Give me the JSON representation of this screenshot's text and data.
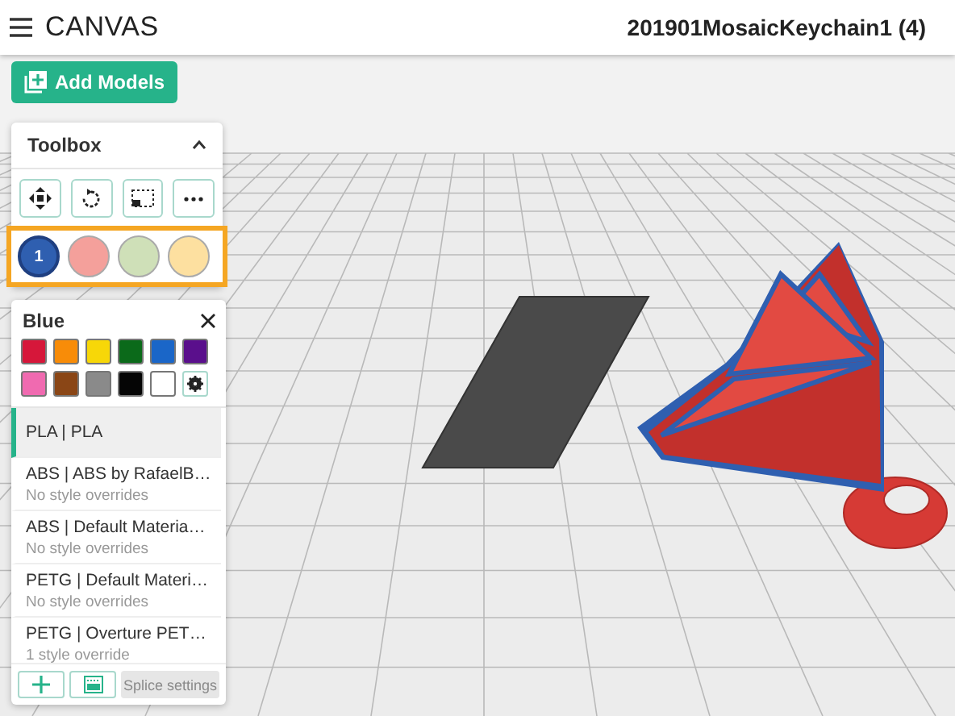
{
  "header": {
    "app_name": "CANVAS",
    "project_title": "201901MosaicKeychain1 (4)"
  },
  "add_models_button": "Add Models",
  "toolbox": {
    "title": "Toolbox",
    "expanded": true,
    "extruders": [
      {
        "label": "1",
        "color": "#2f5fb0",
        "selected": true
      },
      {
        "color": "#f4a09b",
        "selected": false
      },
      {
        "color": "#cfe0b8",
        "selected": false
      },
      {
        "color": "#fde0a0",
        "selected": false
      }
    ]
  },
  "color_panel": {
    "title": "Blue",
    "swatches": [
      {
        "color": "#d6173a"
      },
      {
        "color": "#f88c08"
      },
      {
        "color": "#f7d708"
      },
      {
        "color": "#0b6a1a"
      },
      {
        "color": "#1a66c8"
      },
      {
        "color": "#5a0f8c"
      },
      {
        "color": "#f06ab0"
      },
      {
        "color": "#8a4616"
      },
      {
        "color": "#8a8a8a"
      },
      {
        "color": "#050505"
      },
      {
        "color": "#ffffff"
      }
    ],
    "materials": [
      {
        "name": "PLA | PLA",
        "selected": true
      },
      {
        "name": "ABS | ABS by RafaelB…",
        "detail": "No style overrides",
        "selected": false
      },
      {
        "name": "ABS | Default Materia…",
        "detail": "No style overrides",
        "selected": false
      },
      {
        "name": "PETG | Default Materi…",
        "detail": "No style overrides",
        "selected": false
      },
      {
        "name": "PETG | Overture PET…",
        "detail": "1 style override",
        "selected": false
      }
    ],
    "splice_button": {
      "label": "Splice settings",
      "disabled": true
    }
  }
}
